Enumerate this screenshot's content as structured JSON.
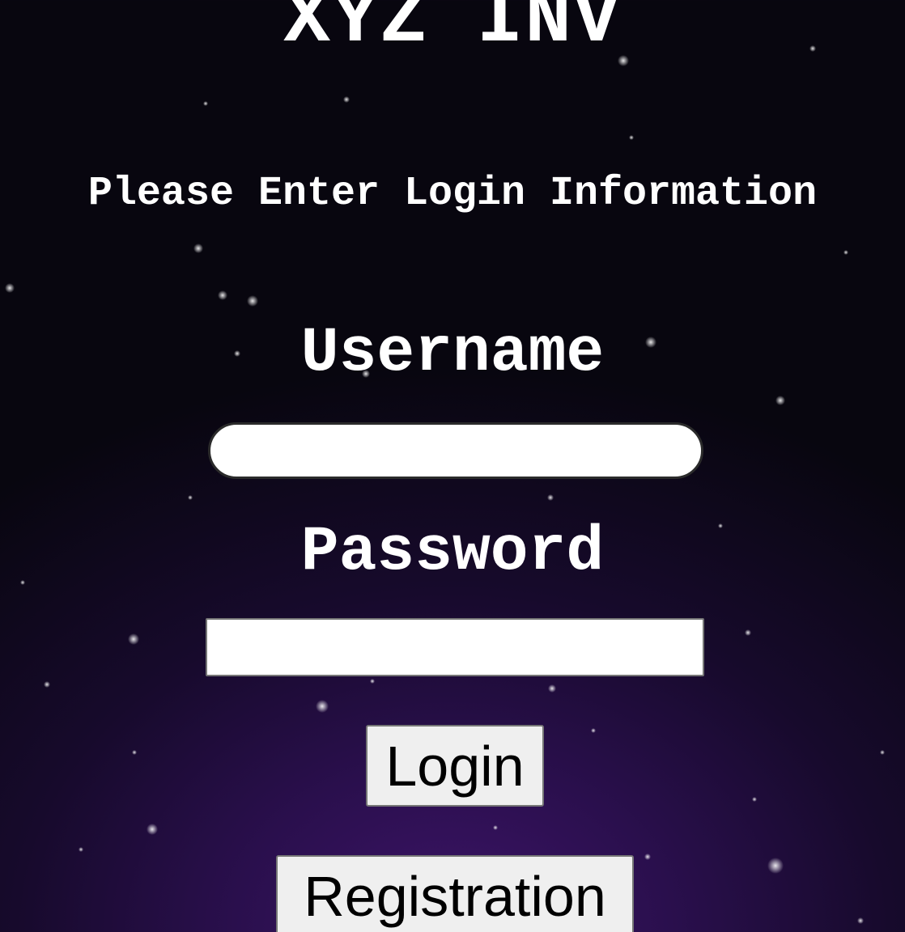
{
  "header": {
    "title": "XYZ INV",
    "subtitle": "Please Enter Login Information"
  },
  "form": {
    "username_label": "Username",
    "username_value": "",
    "password_label": "Password",
    "password_value": "",
    "login_label": "Login",
    "registration_label": "Registration"
  },
  "colors": {
    "background_top": "#08060f",
    "background_bottom": "#3d1468",
    "text": "#ffffff",
    "button_bg": "#efefef"
  }
}
